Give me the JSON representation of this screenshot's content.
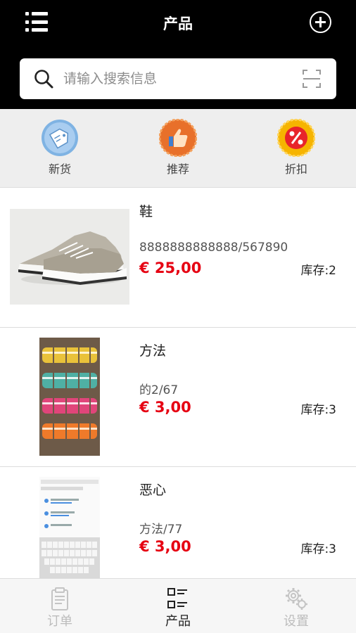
{
  "header": {
    "title": "产品"
  },
  "search": {
    "placeholder": "请输入搜索信息"
  },
  "categories": [
    {
      "label": "新货",
      "icon": "tag-icon"
    },
    {
      "label": "推荐",
      "icon": "thumbs-up-icon"
    },
    {
      "label": "折扣",
      "icon": "percent-icon"
    }
  ],
  "products": [
    {
      "name": "鞋",
      "code": "8888888888888/567890",
      "price": "€ 25,00",
      "stock": "库存:2",
      "image": "sneaker-photo"
    },
    {
      "name": "方法",
      "code": "的2/67",
      "price": "€ 3,00",
      "stock": "库存:3",
      "image": "macarons-photo"
    },
    {
      "name": "恶心",
      "code": "方法/77",
      "price": "€ 3,00",
      "stock": "库存:3",
      "image": "screenshot-thumbnail"
    }
  ],
  "tabs": [
    {
      "label": "订单",
      "icon": "clipboard-icon",
      "active": false
    },
    {
      "label": "产品",
      "icon": "list-icon",
      "active": true
    },
    {
      "label": "设置",
      "icon": "gears-icon",
      "active": false
    }
  ],
  "colors": {
    "header_bg": "#000000",
    "price": "#e60012",
    "category_bar": "#eeeeee"
  }
}
